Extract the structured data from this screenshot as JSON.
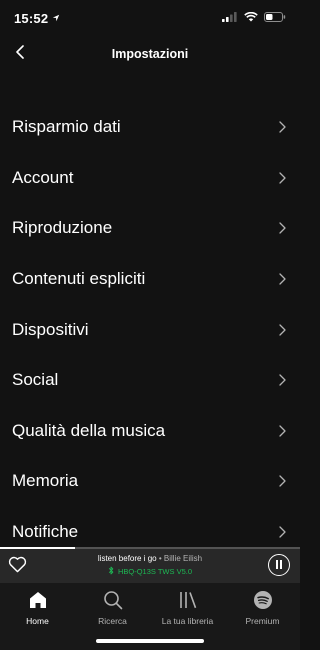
{
  "status_bar": {
    "time": "15:52",
    "icons": [
      "location-arrow-icon",
      "cellular-signal-icon",
      "wifi-icon",
      "battery-icon"
    ],
    "battery_level": 0.4
  },
  "header": {
    "title": "Impostazioni",
    "back_icon": "chevron-left-icon"
  },
  "settings": {
    "items": [
      {
        "label": "Risparmio dati"
      },
      {
        "label": "Account"
      },
      {
        "label": "Riproduzione"
      },
      {
        "label": "Contenuti espliciti"
      },
      {
        "label": "Dispositivi"
      },
      {
        "label": "Social"
      },
      {
        "label": "Qualità della musica"
      },
      {
        "label": "Memoria"
      },
      {
        "label": "Notifiche"
      }
    ],
    "chevron_icon": "chevron-right-icon"
  },
  "player": {
    "track_title": "listen before i go",
    "separator": "•",
    "artist": "Billie Eilish",
    "device": "HBQ-Q13S TWS V5.0",
    "progress": 0.25,
    "like_icon": "heart-outline-icon",
    "pause_icon": "pause-icon",
    "device_icon": "bluetooth-icon"
  },
  "tabs": [
    {
      "label": "Home",
      "icon": "home-icon",
      "active": true
    },
    {
      "label": "Ricerca",
      "icon": "search-icon",
      "active": false
    },
    {
      "label": "La tua libreria",
      "icon": "library-icon",
      "active": false
    },
    {
      "label": "Premium",
      "icon": "spotify-logo-icon",
      "active": false
    }
  ],
  "colors": {
    "background": "#121212",
    "player_background": "#282828",
    "tab_bar_background": "#181818",
    "accent_green": "#1db954",
    "text_primary": "#ffffff",
    "text_secondary": "#b3b3b3"
  }
}
